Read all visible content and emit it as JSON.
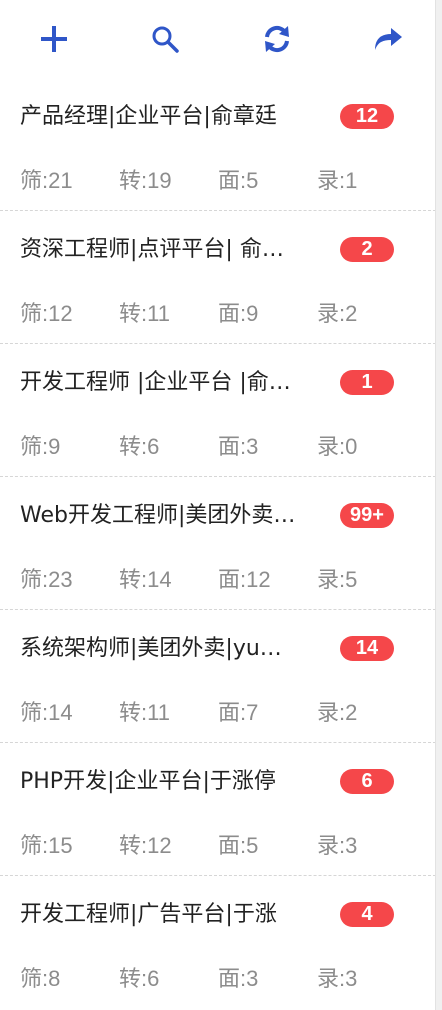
{
  "toolbar": {
    "accent_color": "#2f56c8",
    "buttons": [
      {
        "icon": "plus-icon"
      },
      {
        "icon": "search-icon"
      },
      {
        "icon": "refresh-icon"
      },
      {
        "icon": "share-icon"
      }
    ]
  },
  "stat_labels": {
    "screen": "筛",
    "transfer": "转",
    "interview": "面",
    "hire": "录",
    "separator": ":"
  },
  "badge_color": "#f5474a",
  "jobs": [
    {
      "title": "产品经理|企业平台|俞章廷",
      "badge": "12",
      "screen": "21",
      "transfer": "19",
      "interview": "5",
      "hire": "1"
    },
    {
      "title": "资深工程师|点评平台| 俞…",
      "badge": "2",
      "screen": "12",
      "transfer": "11",
      "interview": "9",
      "hire": "2"
    },
    {
      "title": "开发工程师 |企业平台 |俞…",
      "badge": "1",
      "screen": "9",
      "transfer": "6",
      "interview": "3",
      "hire": "0"
    },
    {
      "title": "Web开发工程师|美团外卖…",
      "badge": "99+",
      "screen": "23",
      "transfer": "14",
      "interview": "12",
      "hire": "5"
    },
    {
      "title": "系统架构师|美团外卖|yu…",
      "badge": "14",
      "screen": "14",
      "transfer": "11",
      "interview": "7",
      "hire": "2"
    },
    {
      "title": "PHP开发|企业平台|于涨停",
      "badge": "6",
      "screen": "15",
      "transfer": "12",
      "interview": "5",
      "hire": "3"
    },
    {
      "title": "开发工程师|广告平台|于涨",
      "badge": "4",
      "screen": "8",
      "transfer": "6",
      "interview": "3",
      "hire": "3"
    }
  ]
}
